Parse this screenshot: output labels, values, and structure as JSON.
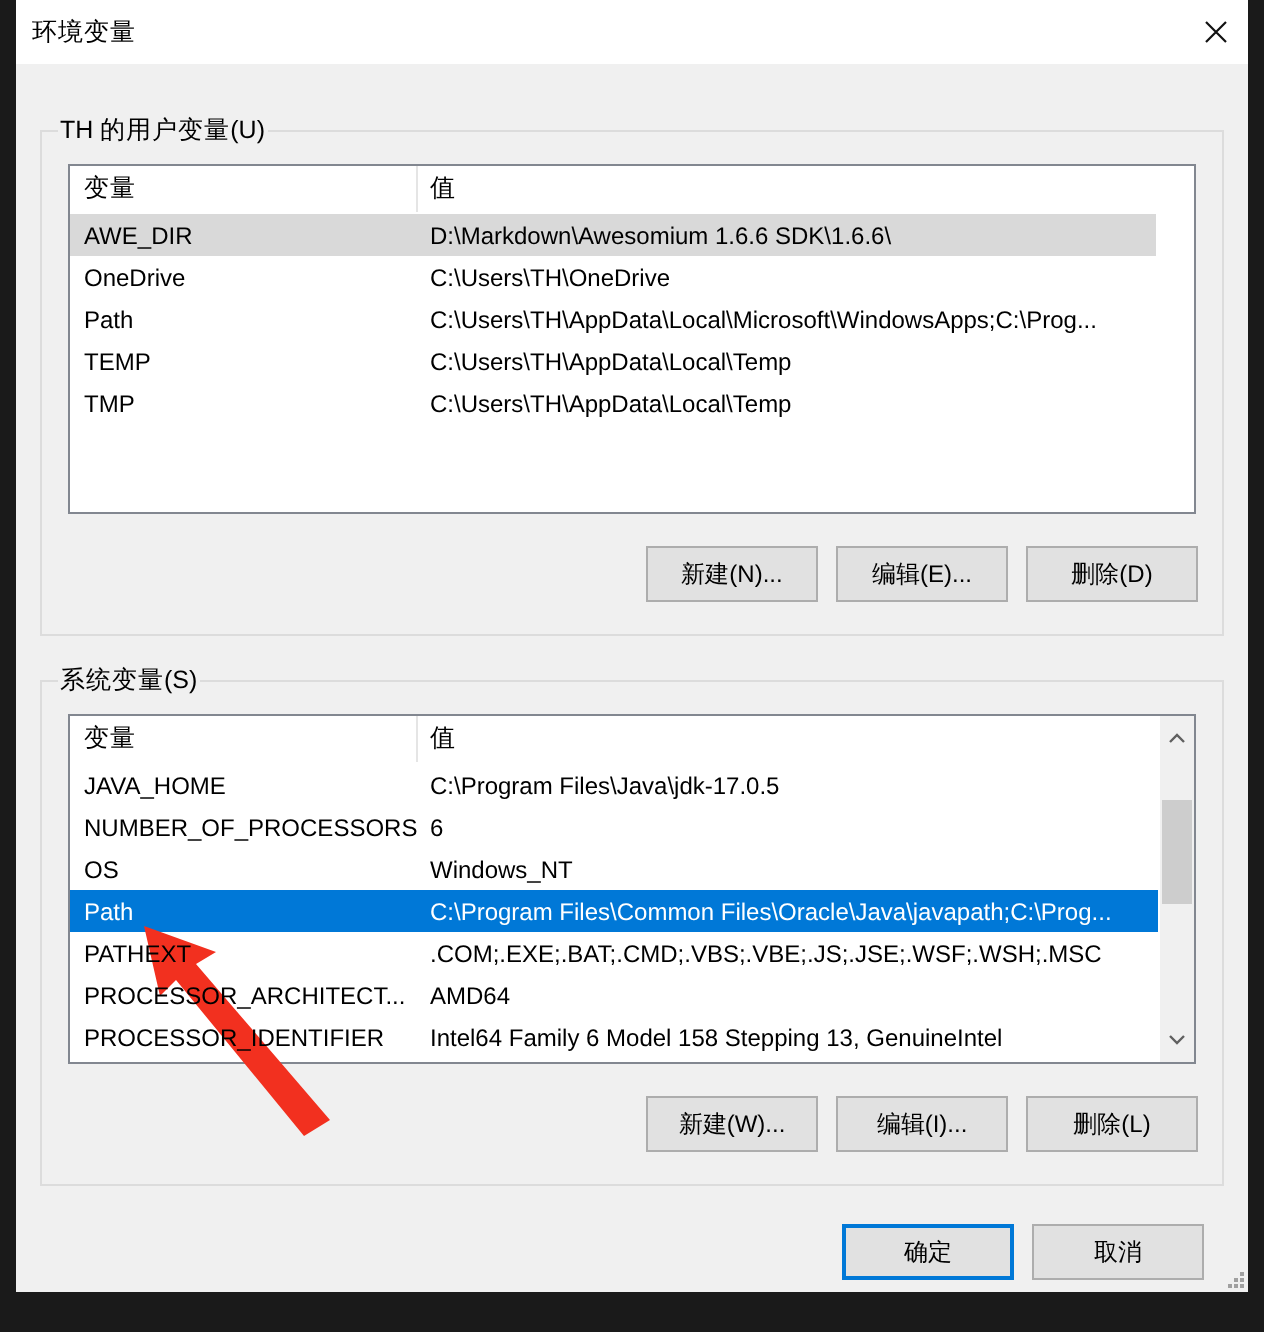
{
  "window": {
    "title": "环境变量"
  },
  "user_vars": {
    "title": "TH 的用户变量(U)",
    "focused": false,
    "columns": [
      "变量",
      "值"
    ],
    "rows": [
      {
        "name": "AWE_DIR",
        "value": "D:\\Markdown\\Awesomium 1.6.6 SDK\\1.6.6\\",
        "selected": true
      },
      {
        "name": "OneDrive",
        "value": "C:\\Users\\TH\\OneDrive",
        "selected": false
      },
      {
        "name": "Path",
        "value": "C:\\Users\\TH\\AppData\\Local\\Microsoft\\WindowsApps;C:\\Prog...",
        "selected": false
      },
      {
        "name": "TEMP",
        "value": "C:\\Users\\TH\\AppData\\Local\\Temp",
        "selected": false
      },
      {
        "name": "TMP",
        "value": "C:\\Users\\TH\\AppData\\Local\\Temp",
        "selected": false
      }
    ],
    "buttons": [
      "新建(N)...",
      "编辑(E)...",
      "删除(D)"
    ]
  },
  "system_vars": {
    "title": "系统变量(S)",
    "focused": true,
    "columns": [
      "变量",
      "值"
    ],
    "rows": [
      {
        "name": "JAVA_HOME",
        "value": "C:\\Program Files\\Java\\jdk-17.0.5",
        "selected": false
      },
      {
        "name": "NUMBER_OF_PROCESSORS",
        "value": "6",
        "selected": false
      },
      {
        "name": "OS",
        "value": "Windows_NT",
        "selected": false
      },
      {
        "name": "Path",
        "value": "C:\\Program Files\\Common Files\\Oracle\\Java\\javapath;C:\\Prog...",
        "selected": true
      },
      {
        "name": "PATHEXT",
        "value": ".COM;.EXE;.BAT;.CMD;.VBS;.VBE;.JS;.JSE;.WSF;.WSH;.MSC",
        "selected": false
      },
      {
        "name": "PROCESSOR_ARCHITECT...",
        "value": "AMD64",
        "selected": false
      },
      {
        "name": "PROCESSOR_IDENTIFIER",
        "value": "Intel64 Family 6 Model 158 Stepping 13, GenuineIntel",
        "selected": false
      }
    ],
    "buttons": [
      "新建(W)...",
      "编辑(I)...",
      "删除(L)"
    ]
  },
  "footer_buttons": [
    {
      "label": "确定",
      "default": true
    },
    {
      "label": "取消",
      "default": false
    }
  ]
}
